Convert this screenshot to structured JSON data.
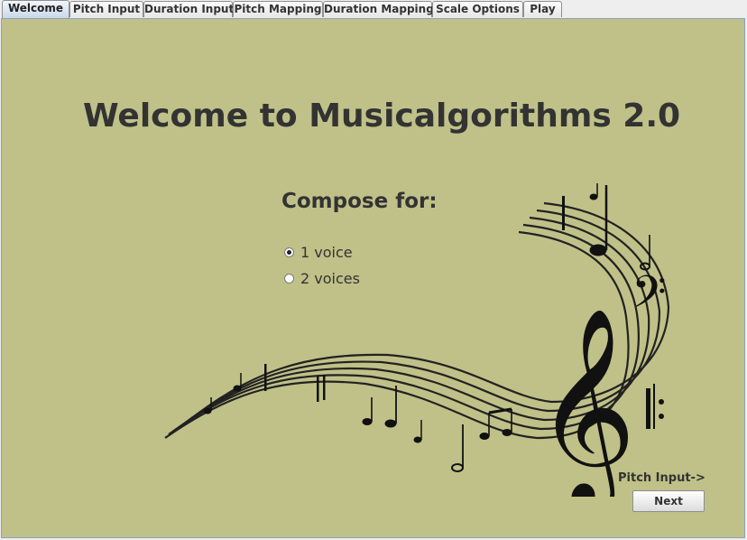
{
  "tabs": [
    "Welcome",
    "Pitch Input",
    "Duration Input",
    "Pitch Mapping",
    "Duration Mapping",
    "Scale Options",
    "Play"
  ],
  "active_tab": "Welcome",
  "title": "Welcome to Musicalgorithms 2.0",
  "compose": {
    "heading": "Compose for:",
    "options": [
      {
        "label": "1 voice",
        "selected": true
      },
      {
        "label": "2 voices",
        "selected": false
      }
    ]
  },
  "footer": {
    "next_hint": "Pitch Input->",
    "next_label": "Next"
  },
  "colors": {
    "panel_bg": "#c0c188",
    "text": "#333333"
  },
  "icons": [
    "music-staff-illustration",
    "treble-clef-icon",
    "bass-clef-icon"
  ]
}
